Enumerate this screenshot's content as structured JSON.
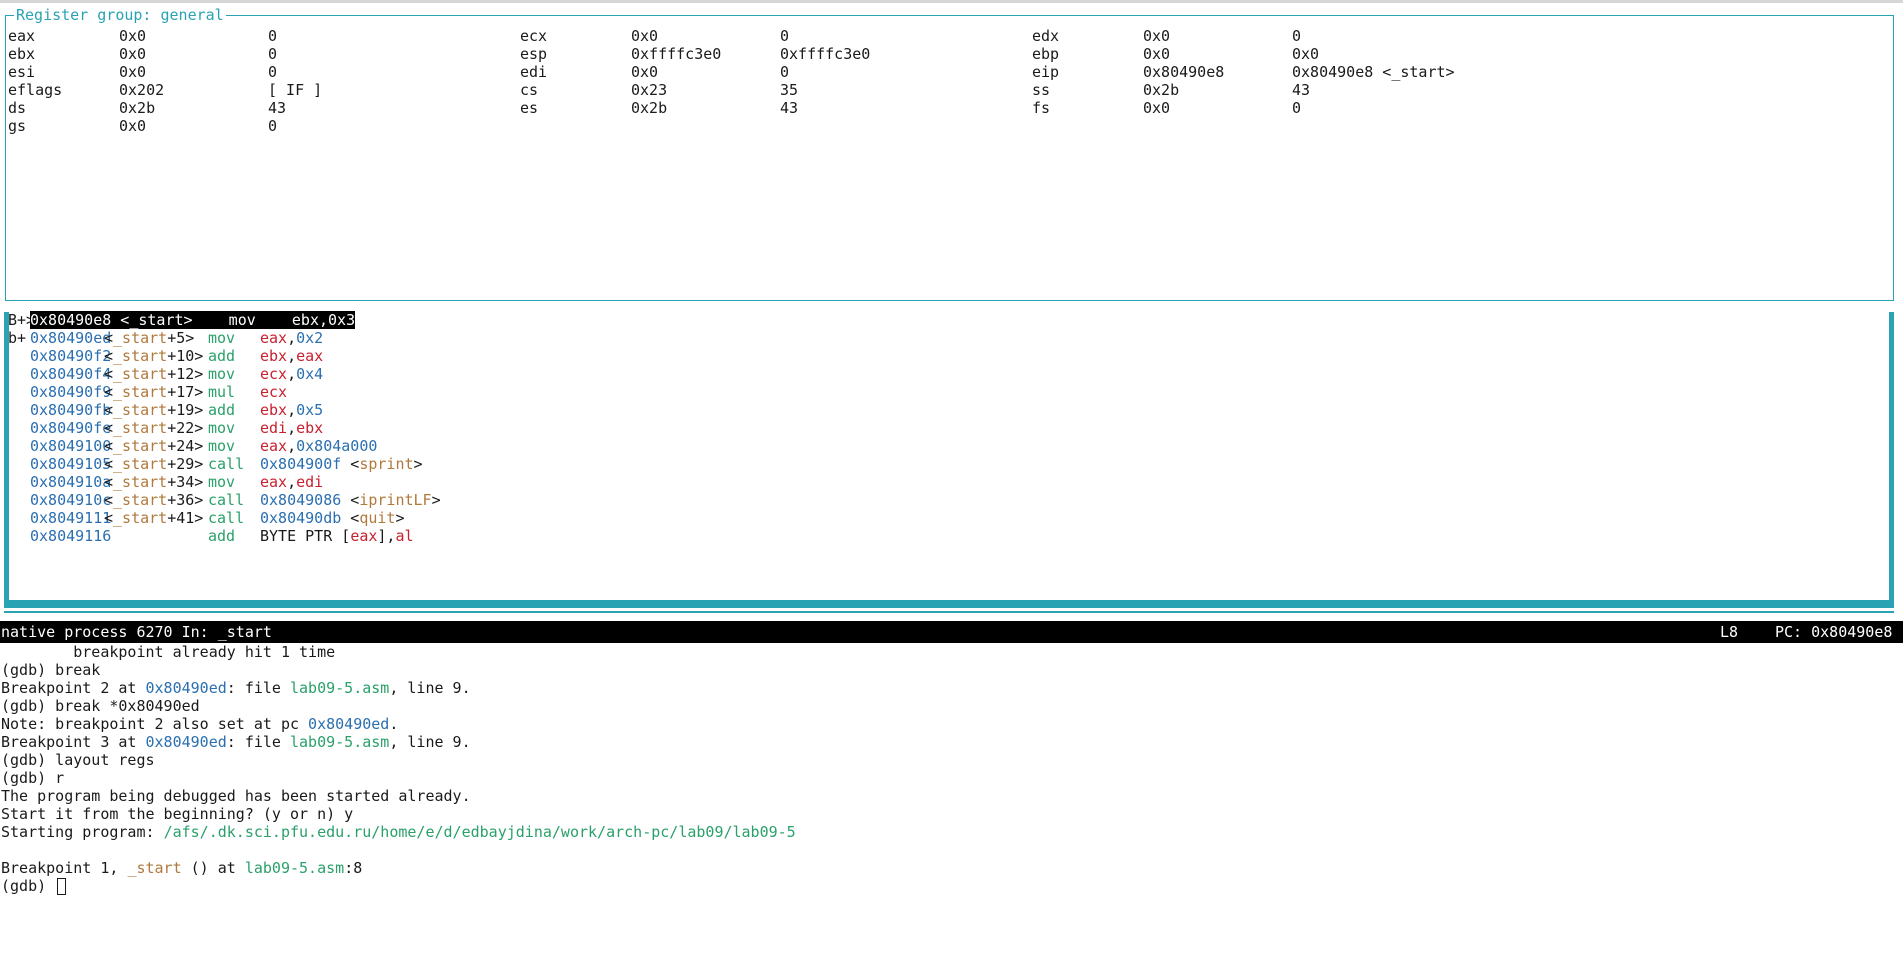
{
  "register_pane": {
    "title": "Register group: general",
    "rows": [
      [
        {
          "name": "eax",
          "hex": "0x0",
          "natural": "0"
        },
        {
          "name": "ecx",
          "hex": "0x0",
          "natural": "0"
        },
        {
          "name": "edx",
          "hex": "0x0",
          "natural": "0"
        }
      ],
      [
        {
          "name": "ebx",
          "hex": "0x0",
          "natural": "0"
        },
        {
          "name": "esp",
          "hex": "0xffffc3e0",
          "natural": "0xffffc3e0"
        },
        {
          "name": "ebp",
          "hex": "0x0",
          "natural": "0x0"
        }
      ],
      [
        {
          "name": "esi",
          "hex": "0x0",
          "natural": "0"
        },
        {
          "name": "edi",
          "hex": "0x0",
          "natural": "0"
        },
        {
          "name": "eip",
          "hex": "0x80490e8",
          "natural": "0x80490e8 <_start>"
        }
      ],
      [
        {
          "name": "eflags",
          "hex": "0x202",
          "natural": "[ IF ]"
        },
        {
          "name": "cs",
          "hex": "0x23",
          "natural": "35"
        },
        {
          "name": "ss",
          "hex": "0x2b",
          "natural": "43"
        }
      ],
      [
        {
          "name": "ds",
          "hex": "0x2b",
          "natural": "43"
        },
        {
          "name": "es",
          "hex": "0x2b",
          "natural": "43"
        },
        {
          "name": "fs",
          "hex": "0x0",
          "natural": "0"
        }
      ],
      [
        {
          "name": "gs",
          "hex": "0x0",
          "natural": "0"
        }
      ]
    ]
  },
  "asm_pane": {
    "lines": [
      {
        "marker": "B+>",
        "addr": "0x80490e8",
        "sym_open": "<",
        "sym": "_start",
        "offset": "",
        "sym_close": ">",
        "op": "mov",
        "operands": [
          {
            "t": "ebx",
            "k": "plain"
          },
          {
            "t": ",",
            "k": "plain"
          },
          {
            "t": "0x3",
            "k": "plain"
          }
        ],
        "current": true
      },
      {
        "marker": "b+ ",
        "addr": "0x80490ed",
        "sym_open": "<",
        "sym": "_start",
        "offset": "+5",
        "sym_close": ">",
        "op": "mov",
        "operands": [
          {
            "t": "eax",
            "k": "reg"
          },
          {
            "t": ",",
            "k": "plain"
          },
          {
            "t": "0x2",
            "k": "num"
          }
        ],
        "current": false
      },
      {
        "marker": "   ",
        "addr": "0x80490f2",
        "sym_open": "<",
        "sym": "_start",
        "offset": "+10",
        "sym_close": ">",
        "op": "add",
        "operands": [
          {
            "t": "ebx",
            "k": "reg"
          },
          {
            "t": ",",
            "k": "plain"
          },
          {
            "t": "eax",
            "k": "reg"
          }
        ],
        "current": false
      },
      {
        "marker": "   ",
        "addr": "0x80490f4",
        "sym_open": "<",
        "sym": "_start",
        "offset": "+12",
        "sym_close": ">",
        "op": "mov",
        "operands": [
          {
            "t": "ecx",
            "k": "reg"
          },
          {
            "t": ",",
            "k": "plain"
          },
          {
            "t": "0x4",
            "k": "num"
          }
        ],
        "current": false
      },
      {
        "marker": "   ",
        "addr": "0x80490f9",
        "sym_open": "<",
        "sym": "_start",
        "offset": "+17",
        "sym_close": ">",
        "op": "mul",
        "operands": [
          {
            "t": "ecx",
            "k": "reg"
          }
        ],
        "current": false
      },
      {
        "marker": "   ",
        "addr": "0x80490fb",
        "sym_open": "<",
        "sym": "_start",
        "offset": "+19",
        "sym_close": ">",
        "op": "add",
        "operands": [
          {
            "t": "ebx",
            "k": "reg"
          },
          {
            "t": ",",
            "k": "plain"
          },
          {
            "t": "0x5",
            "k": "num"
          }
        ],
        "current": false
      },
      {
        "marker": "   ",
        "addr": "0x80490fe",
        "sym_open": "<",
        "sym": "_start",
        "offset": "+22",
        "sym_close": ">",
        "op": "mov",
        "operands": [
          {
            "t": "edi",
            "k": "reg"
          },
          {
            "t": ",",
            "k": "plain"
          },
          {
            "t": "ebx",
            "k": "reg"
          }
        ],
        "current": false
      },
      {
        "marker": "   ",
        "addr": "0x8049100",
        "sym_open": "<",
        "sym": "_start",
        "offset": "+24",
        "sym_close": ">",
        "op": "mov",
        "operands": [
          {
            "t": "eax",
            "k": "reg"
          },
          {
            "t": ",",
            "k": "plain"
          },
          {
            "t": "0x804a000",
            "k": "num"
          }
        ],
        "current": false
      },
      {
        "marker": "   ",
        "addr": "0x8049105",
        "sym_open": "<",
        "sym": "_start",
        "offset": "+29",
        "sym_close": ">",
        "op": "call",
        "operands": [
          {
            "t": "0x804900f",
            "k": "num"
          },
          {
            "t": " <",
            "k": "plain"
          },
          {
            "t": "sprint",
            "k": "sym"
          },
          {
            "t": ">",
            "k": "plain"
          }
        ],
        "current": false
      },
      {
        "marker": "   ",
        "addr": "0x804910a",
        "sym_open": "<",
        "sym": "_start",
        "offset": "+34",
        "sym_close": ">",
        "op": "mov",
        "operands": [
          {
            "t": "eax",
            "k": "reg"
          },
          {
            "t": ",",
            "k": "plain"
          },
          {
            "t": "edi",
            "k": "reg"
          }
        ],
        "current": false
      },
      {
        "marker": "   ",
        "addr": "0x804910c",
        "sym_open": "<",
        "sym": "_start",
        "offset": "+36",
        "sym_close": ">",
        "op": "call",
        "operands": [
          {
            "t": "0x8049086",
            "k": "num"
          },
          {
            "t": " <",
            "k": "plain"
          },
          {
            "t": "iprintLF",
            "k": "sym"
          },
          {
            "t": ">",
            "k": "plain"
          }
        ],
        "current": false
      },
      {
        "marker": "   ",
        "addr": "0x8049111",
        "sym_open": "<",
        "sym": "_start",
        "offset": "+41",
        "sym_close": ">",
        "op": "call",
        "operands": [
          {
            "t": "0x80490db",
            "k": "num"
          },
          {
            "t": " <",
            "k": "plain"
          },
          {
            "t": "quit",
            "k": "sym"
          },
          {
            "t": ">",
            "k": "plain"
          }
        ],
        "current": false
      },
      {
        "marker": "   ",
        "addr": "0x8049116",
        "sym_open": "",
        "sym": "",
        "offset": "",
        "sym_close": "",
        "op": "add",
        "operands": [
          {
            "t": "BYTE PTR [",
            "k": "plain"
          },
          {
            "t": "eax",
            "k": "reg"
          },
          {
            "t": "],",
            "k": "plain"
          },
          {
            "t": "al",
            "k": "reg"
          }
        ],
        "current": false
      }
    ]
  },
  "status_bar": {
    "left": "native process 6270 In: _start",
    "line": "L8",
    "pc": "PC: 0x80490e8"
  },
  "command_pane": {
    "lines": [
      [
        {
          "t": "        breakpoint already hit 1 time",
          "k": "plain"
        }
      ],
      [
        {
          "t": "(gdb) break",
          "k": "plain"
        }
      ],
      [
        {
          "t": "Breakpoint 2 at ",
          "k": "plain"
        },
        {
          "t": "0x80490ed",
          "k": "addr"
        },
        {
          "t": ": file ",
          "k": "plain"
        },
        {
          "t": "lab09-5.asm",
          "k": "file"
        },
        {
          "t": ", line 9.",
          "k": "plain"
        }
      ],
      [
        {
          "t": "(gdb) break *0x80490ed",
          "k": "plain"
        }
      ],
      [
        {
          "t": "Note: breakpoint 2 also set at pc ",
          "k": "plain"
        },
        {
          "t": "0x80490ed",
          "k": "addr"
        },
        {
          "t": ".",
          "k": "plain"
        }
      ],
      [
        {
          "t": "Breakpoint 3 at ",
          "k": "plain"
        },
        {
          "t": "0x80490ed",
          "k": "addr"
        },
        {
          "t": ": file ",
          "k": "plain"
        },
        {
          "t": "lab09-5.asm",
          "k": "file"
        },
        {
          "t": ", line 9.",
          "k": "plain"
        }
      ],
      [
        {
          "t": "(gdb) layout regs",
          "k": "plain"
        }
      ],
      [
        {
          "t": "(gdb) r",
          "k": "plain"
        }
      ],
      [
        {
          "t": "The program being debugged has been started already.",
          "k": "plain"
        }
      ],
      [
        {
          "t": "Start it from the beginning? (y or n) y",
          "k": "plain"
        }
      ],
      [
        {
          "t": "Starting program: ",
          "k": "plain"
        },
        {
          "t": "/afs/.dk.sci.pfu.edu.ru/home/e/d/edbayjdina/work/arch-pc/lab09/lab09-5",
          "k": "file"
        }
      ],
      [
        {
          "t": "",
          "k": "plain"
        }
      ],
      [
        {
          "t": "Breakpoint 1, ",
          "k": "plain"
        },
        {
          "t": "_start",
          "k": "sym"
        },
        {
          "t": " () at ",
          "k": "plain"
        },
        {
          "t": "lab09-5.asm",
          "k": "file"
        },
        {
          "t": ":8",
          "k": "plain"
        }
      ]
    ],
    "prompt": "(gdb) "
  },
  "colors": {
    "border": "#29a3b3",
    "address": "#2a6fb0",
    "symbol": "#b07a3c",
    "opcode": "#2aa06a",
    "register": "#c8202e",
    "filename": "#2aa06a"
  }
}
